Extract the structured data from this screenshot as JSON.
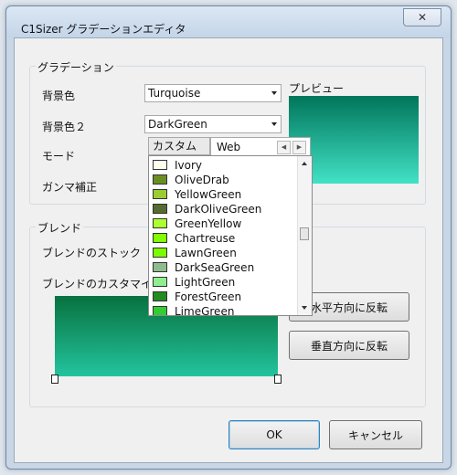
{
  "window": {
    "title": "C1Sizer グラデーションエディタ",
    "close_glyph": "✕"
  },
  "gradient_group": {
    "label": "グラデーション",
    "bg_color_label": "背景色",
    "bg_color_value": "Turquoise",
    "bg_color2_label": "背景色２",
    "bg_color2_value": "DarkGreen",
    "mode_label": "モード",
    "gamma_label": "ガンマ補正",
    "preview_label": "プレビュー"
  },
  "color_picker": {
    "tabs": [
      "カスタム",
      "Web"
    ],
    "prev_glyph": "◀",
    "next_glyph": "▶",
    "items": [
      {
        "name": "Ivory",
        "color": "#fffff0"
      },
      {
        "name": "OliveDrab",
        "color": "#6b8e23"
      },
      {
        "name": "YellowGreen",
        "color": "#9acd32"
      },
      {
        "name": "DarkOliveGreen",
        "color": "#556b2f"
      },
      {
        "name": "GreenYellow",
        "color": "#adff2f"
      },
      {
        "name": "Chartreuse",
        "color": "#7fff00"
      },
      {
        "name": "LawnGreen",
        "color": "#7cfc00"
      },
      {
        "name": "DarkSeaGreen",
        "color": "#8fbc8f"
      },
      {
        "name": "LightGreen",
        "color": "#90ee90"
      },
      {
        "name": "ForestGreen",
        "color": "#228b22"
      },
      {
        "name": "LimeGreen",
        "color": "#32cd32"
      }
    ]
  },
  "blend_group": {
    "label": "ブレンド",
    "stock_label": "ブレンドのストック",
    "custom_label": "ブレンドのカスタマイ",
    "flip_horizontal": "水平方向に反転",
    "flip_vertical": "垂直方向に反転"
  },
  "footer": {
    "ok": "OK",
    "cancel": "キャンセル"
  }
}
